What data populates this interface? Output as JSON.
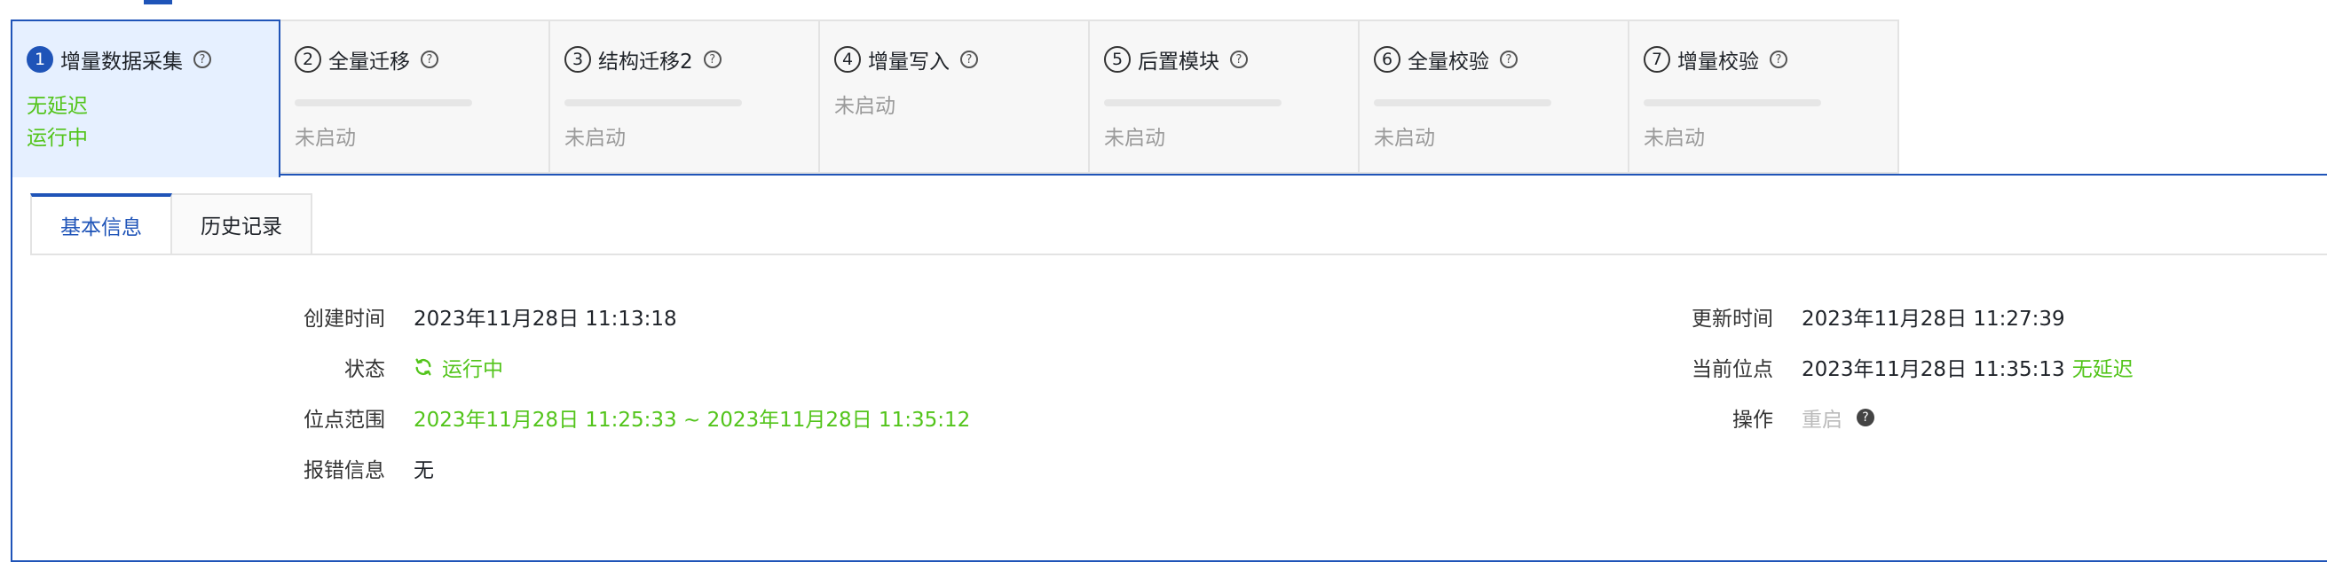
{
  "steps": [
    {
      "num": "1",
      "title": "增量数据采集",
      "lag": "无延迟",
      "status": "运行中"
    },
    {
      "num": "2",
      "title": "全量迁移",
      "status": "未启动"
    },
    {
      "num": "3",
      "title": "结构迁移2",
      "status": "未启动"
    },
    {
      "num": "4",
      "title": "增量写入",
      "status": "未启动"
    },
    {
      "num": "5",
      "title": "后置模块",
      "status": "未启动"
    },
    {
      "num": "6",
      "title": "全量校验",
      "status": "未启动"
    },
    {
      "num": "7",
      "title": "增量校验",
      "status": "未启动"
    }
  ],
  "help_glyph": "?",
  "tabs": {
    "basic": "基本信息",
    "history": "历史记录"
  },
  "info": {
    "created_label": "创建时间",
    "created_value": "2023年11月28日 11:13:18",
    "state_label": "状态",
    "state_value": "运行中",
    "range_label": "位点范围",
    "range_value": "2023年11月28日 11:25:33 ~ 2023年11月28日 11:35:12",
    "error_label": "报错信息",
    "error_value": "无",
    "updated_label": "更新时间",
    "updated_value": "2023年11月28日 11:27:39",
    "position_label": "当前位点",
    "position_value": "2023年11月28日 11:35:13",
    "position_lag": "无延迟",
    "action_label": "操作",
    "action_value": "重启"
  },
  "colors": {
    "accent": "#1f54b8",
    "success": "#52c41a",
    "muted": "#9a9a9a",
    "active_bg": "#e6f0ff"
  },
  "icons": {
    "state": "sync-icon",
    "help": "question-circle-icon"
  }
}
